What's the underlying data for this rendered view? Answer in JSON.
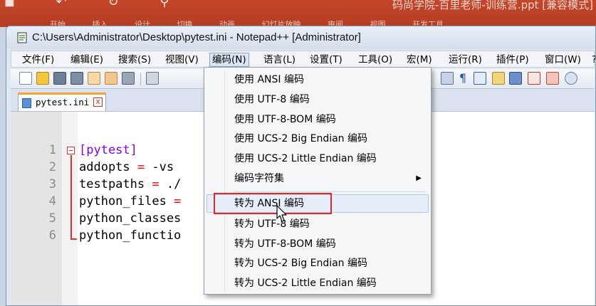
{
  "background_app": {
    "title": "码尚学院-百里老师-训练营.ppt [兼容模式]",
    "tab_fragments": "开始 插入 设计 切换 动画 幻灯片放映 审阅 视图 开发工具"
  },
  "window": {
    "title": "C:\\Users\\Administrator\\Desktop\\pytest.ini - Notepad++ [Administrator]"
  },
  "menubar": {
    "items": [
      {
        "label": "文件(F)"
      },
      {
        "label": "编辑(E)"
      },
      {
        "label": "搜索(S)"
      },
      {
        "label": "视图(V)"
      },
      {
        "label": "编码(N)",
        "active": true
      },
      {
        "label": "语言(L)"
      },
      {
        "label": "设置(T)"
      },
      {
        "label": "工具(O)"
      },
      {
        "label": "宏(M)"
      },
      {
        "label": "运行(R)"
      },
      {
        "label": "插件(P)"
      },
      {
        "label": "窗口(W)"
      },
      {
        "label": "?"
      }
    ]
  },
  "toolbar": {
    "icons": [
      "new-file-icon",
      "open-file-icon",
      "save-icon",
      "save-all-icon",
      "close-icon",
      "close-all-icon",
      "print-icon",
      "cut-icon"
    ],
    "right_icons": [
      "word-wrap-icon",
      "show-all-chars-icon",
      "indent-guide-icon",
      "doc-map-icon",
      "function-list-icon",
      "folder-workspace-icon",
      "monitor-icon"
    ]
  },
  "tab": {
    "filename": "pytest.ini",
    "close_glyph": "x"
  },
  "editor": {
    "line_numbers": [
      "1",
      "2",
      "3",
      "4",
      "5",
      "6"
    ],
    "lines": [
      {
        "section": "[pytest]"
      },
      {
        "key": "addopts",
        "op": " = ",
        "value": "-vs"
      },
      {
        "key": "testpaths",
        "op": " = ",
        "value": "./"
      },
      {
        "key": "python_files",
        "op": " =",
        "value": ""
      },
      {
        "key": "python_classes",
        "op": "",
        "value": ""
      },
      {
        "key": "python_functio",
        "op": "",
        "value": ""
      }
    ]
  },
  "encoding_menu": {
    "items": [
      {
        "label": "使用 ANSI 编码"
      },
      {
        "label": "使用 UTF-8 编码"
      },
      {
        "label": "使用 UTF-8-BOM 编码"
      },
      {
        "label": "使用 UCS-2 Big Endian 编码"
      },
      {
        "label": "使用 UCS-2 Little Endian 编码"
      },
      {
        "label": "编码字符集",
        "submenu": true
      },
      {
        "label": "转为 ANSI 编码",
        "highlighted": true
      },
      {
        "label": "转为 UTF-8 编码"
      },
      {
        "label": "转为 UTF-8-BOM 编码"
      },
      {
        "label": "转为 UCS-2 Big Endian 编码"
      },
      {
        "label": "转为 UCS-2 Little Endian 编码"
      }
    ],
    "submenu_arrow": "▶"
  },
  "colors": {
    "section": "#8000ff",
    "operator": "#ff0000",
    "annotation_frame": "#e32626",
    "active_tab_accent": "#f7a33a"
  }
}
